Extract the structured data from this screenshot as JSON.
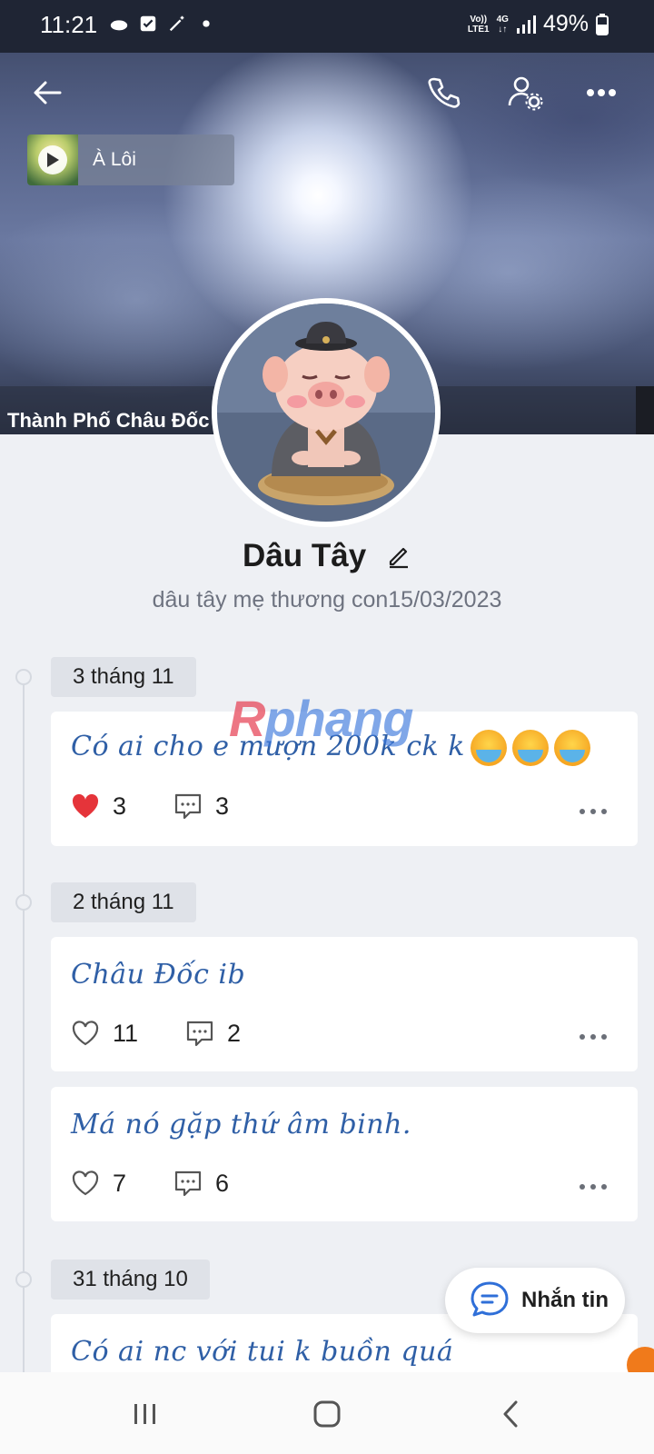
{
  "status_bar": {
    "time": "11:21",
    "network_top": "Vo))",
    "network_bottom": "LTE1",
    "net_gen": "4G",
    "battery": "49%"
  },
  "cover": {
    "music_title": "À Lôi",
    "location": "Thành Phố Châu Đốc"
  },
  "profile": {
    "name": "Dâu Tây",
    "bio": "dâu tây mẹ thương con15/03/2023"
  },
  "watermark": {
    "part1": "R",
    "part2": "phang"
  },
  "timeline": [
    {
      "date": "3 tháng 11",
      "posts": [
        {
          "text": "Có ai cho e mượn 200k ck k",
          "likes": "3",
          "comments": "3",
          "liked": true
        }
      ]
    },
    {
      "date": "2 tháng 11",
      "posts": [
        {
          "text": "Châu Đốc ib",
          "likes": "11",
          "comments": "2",
          "liked": false
        },
        {
          "text": "Má nó gặp thứ âm binh.",
          "likes": "7",
          "comments": "6",
          "liked": false
        }
      ]
    },
    {
      "date": "31 tháng 10",
      "posts": [
        {
          "text": "Có ai nc với tui k buồn quá"
        }
      ]
    }
  ],
  "actions": {
    "message_label": "Nhắn tin"
  },
  "colors": {
    "accent_blue": "#2f5fa6",
    "heart_red": "#e5343a"
  }
}
